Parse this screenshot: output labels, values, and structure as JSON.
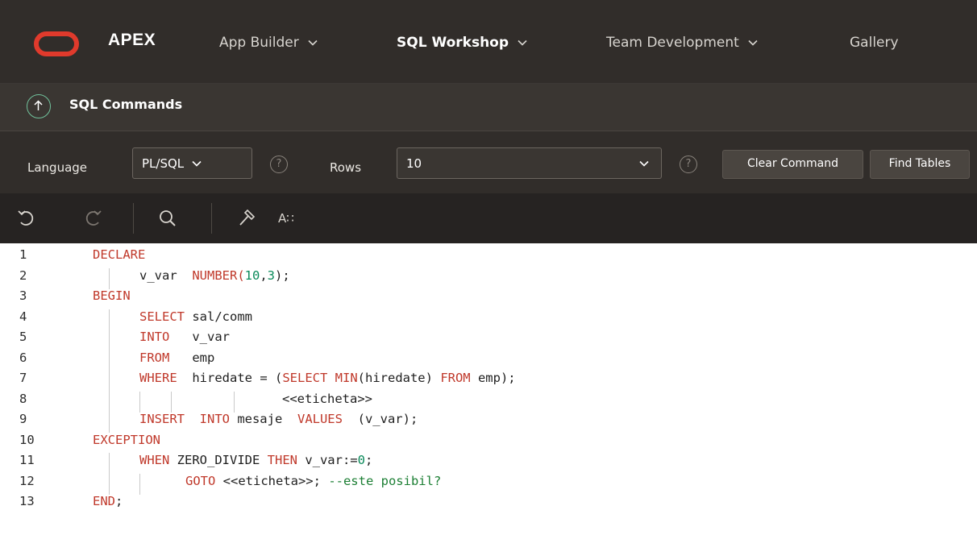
{
  "app": {
    "brand": "APEX",
    "colors": {
      "accent": "#e03a2c",
      "header_bg": "#312d2a",
      "keyword": "#c0392b",
      "number": "#0a8a5a",
      "comment": "#1c7f34"
    }
  },
  "nav": {
    "items": [
      {
        "label": "App Builder",
        "has_menu": true
      },
      {
        "label": "SQL Workshop",
        "has_menu": true,
        "active": true
      },
      {
        "label": "Team Development",
        "has_menu": true
      },
      {
        "label": "Gallery",
        "has_menu": false
      }
    ]
  },
  "page": {
    "title": "SQL Commands",
    "up_icon": "arrow-up-circle-icon"
  },
  "toolbar": {
    "language_label": "Language",
    "language_value": "PL/SQL",
    "help_glyph": "?",
    "rows_label": "Rows",
    "rows_value": "10",
    "clear_label": "Clear Command",
    "find_label": "Find Tables"
  },
  "editor_tools": {
    "undo": "undo-icon",
    "redo": "redo-icon",
    "search": "search-icon",
    "format": "hammer-icon",
    "autocomplete_label": "A∷"
  },
  "editor": {
    "lines": [
      {
        "n": "1",
        "t": [
          [
            "kw",
            "DECLARE"
          ]
        ]
      },
      {
        "n": "2",
        "t": [
          [
            "tx",
            "v_var  "
          ],
          [
            "kw",
            "NUMBER("
          ],
          [
            "num",
            "10"
          ],
          [
            "tx",
            ","
          ],
          [
            "num",
            "3"
          ],
          [
            "tx",
            ");"
          ]
        ]
      },
      {
        "n": "3",
        "t": [
          [
            "kw",
            "BEGIN"
          ]
        ]
      },
      {
        "n": "4",
        "t": [
          [
            "kw",
            "SELECT "
          ],
          [
            "tx",
            "sal/comm"
          ]
        ]
      },
      {
        "n": "5",
        "t": [
          [
            "kw",
            "INTO"
          ],
          [
            "tx",
            "   v_var"
          ]
        ]
      },
      {
        "n": "6",
        "t": [
          [
            "kw",
            "FROM"
          ],
          [
            "tx",
            "   emp"
          ]
        ]
      },
      {
        "n": "7",
        "t": [
          [
            "kw",
            "WHERE"
          ],
          [
            "tx",
            "  hiredate = ("
          ],
          [
            "kw",
            "SELECT MIN"
          ],
          [
            "tx",
            "(hiredate) "
          ],
          [
            "kw",
            "FROM"
          ],
          [
            "tx",
            " emp);"
          ]
        ]
      },
      {
        "n": "8",
        "t": [
          [
            "tx",
            "<<eticheta>>"
          ]
        ]
      },
      {
        "n": "9",
        "t": [
          [
            "kw",
            "INSERT  INTO"
          ],
          [
            "tx",
            " mesaje  "
          ],
          [
            "kw",
            "VALUES"
          ],
          [
            "tx",
            "  (v_var);"
          ]
        ]
      },
      {
        "n": "10",
        "t": [
          [
            "kw",
            "EXCEPTION"
          ]
        ]
      },
      {
        "n": "11",
        "t": [
          [
            "kw",
            "WHEN"
          ],
          [
            "tx",
            " ZERO_DIVIDE "
          ],
          [
            "kw",
            "THEN"
          ],
          [
            "tx",
            " v_var:="
          ],
          [
            "num",
            "0"
          ],
          [
            "tx",
            ";"
          ]
        ]
      },
      {
        "n": "12",
        "t": [
          [
            "kw",
            "GOTO"
          ],
          [
            "tx",
            " <<eticheta>>; "
          ],
          [
            "cm",
            "--este posibil?"
          ]
        ]
      },
      {
        "n": "13",
        "t": [
          [
            "kw",
            "END"
          ],
          [
            "tx",
            ";"
          ]
        ]
      }
    ]
  }
}
